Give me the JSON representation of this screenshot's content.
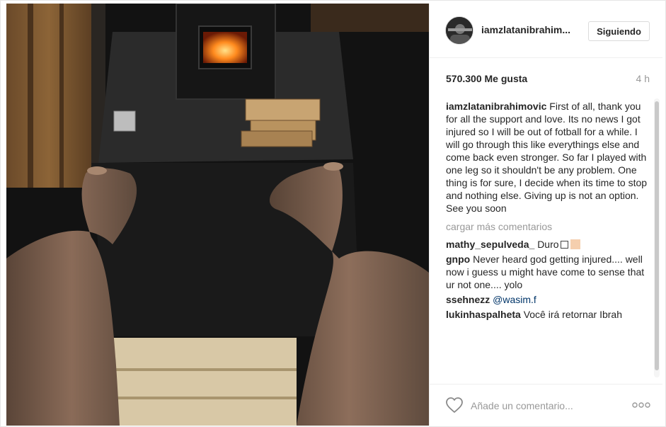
{
  "post": {
    "image_alt": "photo",
    "username": "iamzlatanibrahim...",
    "follow_label": "Siguiendo",
    "likes": "570.300 Me gusta",
    "time": "4 h",
    "caption": {
      "user": "iamzlatanibrahimovic",
      "text": "First of all, thank you for all the support and love. Its no news I got injured so I will be out of fotball for a while. I will go through this like everythings else and come back even stronger. So far I played with one leg so it shouldn't be any problem. One thing is for sure, I decide when its time to stop and nothing else. Giving up is not an option. See you soon"
    },
    "load_more": "cargar más comentarios",
    "comments": [
      {
        "user": "mathy_sepulveda_",
        "text": "Duro"
      },
      {
        "user": "gnpo",
        "text": "Never heard god getting injured.... well now i guess u might have come to sense that ur not one.... yolo"
      },
      {
        "user": "ssehnezz",
        "mention": "@wasim.f"
      },
      {
        "user": "lukinhaspalheta",
        "text": "Você irá retornar Ibrah"
      }
    ],
    "add_comment_placeholder": "Añade un comentario...",
    "icons": {
      "like": "heart-icon",
      "options": "more-options-icon",
      "avatar": "avatar"
    },
    "colors": {
      "text": "#262626",
      "muted": "#999999",
      "border": "#efefef",
      "mention": "#003569"
    }
  }
}
